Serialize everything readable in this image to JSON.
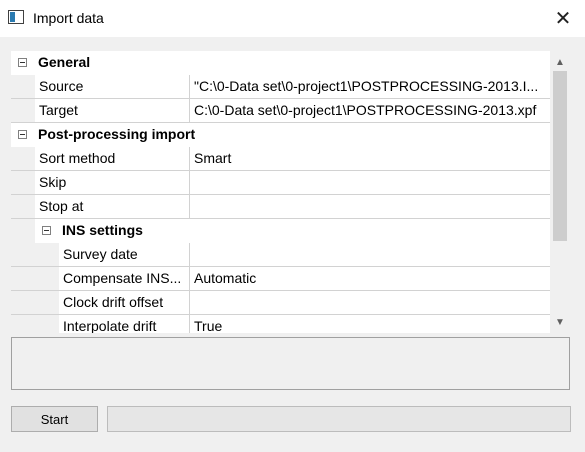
{
  "window": {
    "title": "Import data"
  },
  "grid": {
    "general": {
      "label": "General",
      "source": {
        "name": "Source",
        "value": "\"C:\\0-Data set\\0-project1\\POSTPROCESSING-2013.I..."
      },
      "target": {
        "name": "Target",
        "value": "C:\\0-Data set\\0-project1\\POSTPROCESSING-2013.xpf"
      }
    },
    "postprocessing": {
      "label": "Post-processing import",
      "sort": {
        "name": "Sort method",
        "value": "Smart"
      },
      "skip": {
        "name": "Skip",
        "value": ""
      },
      "stop": {
        "name": "Stop at",
        "value": ""
      },
      "ins": {
        "label": "INS settings",
        "survey_date": {
          "name": "Survey date",
          "value": ""
        },
        "compensate": {
          "name": "Compensate INS...",
          "value": "Automatic"
        },
        "clock_drift": {
          "name": "Clock drift offset",
          "value": ""
        },
        "interpolate": {
          "name": "Interpolate drift",
          "value": "True"
        }
      }
    }
  },
  "buttons": {
    "start": "Start"
  },
  "progress": {
    "fraction": 0
  },
  "colors": {
    "progress_fill": "#06b025"
  }
}
